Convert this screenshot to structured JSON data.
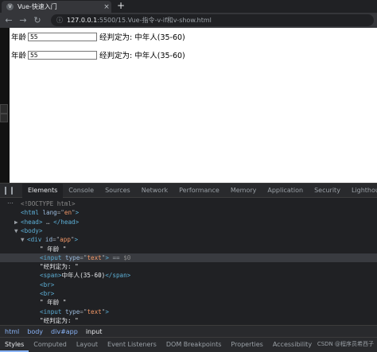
{
  "browser": {
    "tab_title": "Vue-快速入门",
    "tab_favicon": "V",
    "close_glyph": "×",
    "new_tab_glyph": "+",
    "url_host": "127.0.0.1",
    "url_path": ":5500/15.Vue-指令-v-if和v-show.html"
  },
  "page": {
    "row1": {
      "label": "年龄",
      "input_value": "55",
      "result": "经判定为: 中年人(35-60)"
    },
    "row2": {
      "label": "年龄",
      "input_value": "55",
      "result": "经判定为: 中年人(35-60)"
    }
  },
  "devtools": {
    "tabs": [
      "Elements",
      "Console",
      "Sources",
      "Network",
      "Performance",
      "Memory",
      "Application",
      "Security",
      "Lighthouse"
    ],
    "active_tab": "Elements",
    "dom_lines": [
      {
        "indent": 1,
        "tri": "",
        "parts": [
          [
            "cmt",
            "<!DOCTYPE html>"
          ]
        ]
      },
      {
        "indent": 1,
        "tri": "",
        "parts": [
          [
            "tag",
            "<html"
          ],
          [
            "attr",
            " lang"
          ],
          [
            "eq",
            "=\""
          ],
          [
            "val",
            "en"
          ],
          [
            "eq",
            "\""
          ],
          [
            "tag",
            ">"
          ]
        ]
      },
      {
        "indent": 1,
        "tri": "▶",
        "parts": [
          [
            "tag",
            "<head>"
          ],
          [
            "ell",
            " … "
          ],
          [
            "tag",
            "</head>"
          ]
        ]
      },
      {
        "indent": 1,
        "tri": "▼",
        "parts": [
          [
            "tag",
            "<body>"
          ]
        ]
      },
      {
        "indent": 2,
        "tri": "▼",
        "parts": [
          [
            "tag",
            "<div"
          ],
          [
            "attr",
            " id"
          ],
          [
            "eq",
            "=\""
          ],
          [
            "val",
            "app"
          ],
          [
            "eq",
            "\""
          ],
          [
            "tag",
            ">"
          ]
        ]
      },
      {
        "indent": 4,
        "tri": "",
        "parts": [
          [
            "txt",
            "\" 年龄 \""
          ]
        ]
      },
      {
        "indent": 4,
        "tri": "",
        "hl": true,
        "parts": [
          [
            "tag",
            "<input"
          ],
          [
            "attr",
            " type"
          ],
          [
            "eq",
            "=\""
          ],
          [
            "val",
            "text"
          ],
          [
            "eq",
            "\""
          ],
          [
            "tag",
            ">"
          ],
          [
            "eq",
            " == "
          ],
          [
            "cmt",
            "$0"
          ]
        ]
      },
      {
        "indent": 4,
        "tri": "",
        "parts": [
          [
            "txt",
            "\"经判定为: \""
          ]
        ]
      },
      {
        "indent": 4,
        "tri": "",
        "parts": [
          [
            "tag",
            "<span>"
          ],
          [
            "txt",
            "中年人(35-60)"
          ],
          [
            "tag",
            "</span>"
          ]
        ]
      },
      {
        "indent": 4,
        "tri": "",
        "parts": [
          [
            "tag",
            "<br>"
          ]
        ]
      },
      {
        "indent": 4,
        "tri": "",
        "parts": [
          [
            "tag",
            "<br>"
          ]
        ]
      },
      {
        "indent": 4,
        "tri": "",
        "parts": [
          [
            "txt",
            "\" 年龄 \""
          ]
        ]
      },
      {
        "indent": 4,
        "tri": "",
        "parts": [
          [
            "tag",
            "<input"
          ],
          [
            "attr",
            " type"
          ],
          [
            "eq",
            "=\""
          ],
          [
            "val",
            "text"
          ],
          [
            "eq",
            "\""
          ],
          [
            "tag",
            ">"
          ]
        ]
      },
      {
        "indent": 4,
        "tri": "",
        "parts": [
          [
            "txt",
            "\"经判定为: \""
          ]
        ]
      }
    ],
    "breadcrumbs": [
      "html",
      "body",
      "div#app",
      "input"
    ],
    "sub_tabs": [
      "Styles",
      "Computed",
      "Layout",
      "Event Listeners",
      "DOM Breakpoints",
      "Properties",
      "Accessibility"
    ],
    "active_sub_tab": "Styles",
    "ellipsis": "…",
    "watermark": "CSDN @程序员希西子"
  }
}
